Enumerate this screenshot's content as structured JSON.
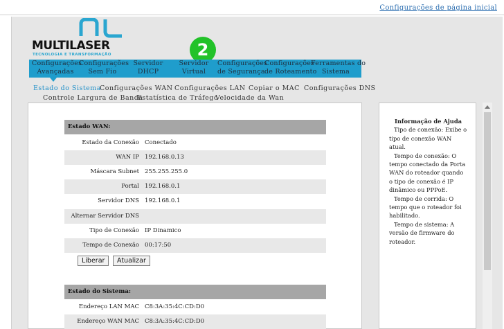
{
  "top": {
    "link": "Configurações de página inicial"
  },
  "logo": {
    "brand": "MULTILASER",
    "tagline": "TECNOLOGIA E TRANSFORMAÇÃO"
  },
  "badge": "2",
  "menu": [
    {
      "line1": "Configurações",
      "line2": "Avançadas"
    },
    {
      "line1": "Configurações",
      "line2": "Sem Fio"
    },
    {
      "line1": "Servidor",
      "line2": "DHCP"
    },
    {
      "line1": "Servidor",
      "line2": "Virtual"
    },
    {
      "line1": "Configurações",
      "line2": "de Segurança"
    },
    {
      "line1": "Configurações",
      "line2": "de Roteamento"
    },
    {
      "line1": "Ferramentas do",
      "line2": "Sistema"
    }
  ],
  "submenu": {
    "row1": [
      "Estado do Sistema",
      "Configurações WAN",
      "Configurações LAN",
      "Copiar o MAC",
      "Configurações DNS"
    ],
    "row2": [
      "Controle Largura de Banda",
      "Estatística de Tráfego",
      "Velocidade da Wan"
    ]
  },
  "wan": {
    "header": "Estado WAN:",
    "rows": [
      {
        "label": "Estado da Conexão",
        "value": "Conectado"
      },
      {
        "label": "WAN IP",
        "value": "192.168.0.13"
      },
      {
        "label": "Máscara Subnet",
        "value": "255.255.255.0"
      },
      {
        "label": "Portal",
        "value": "192.168.0.1"
      },
      {
        "label": "Servidor DNS",
        "value": "192.168.0.1"
      },
      {
        "label": "Alternar Servidor DNS",
        "value": ""
      },
      {
        "label": "Tipo de Conexão",
        "value": "IP Dinamico"
      },
      {
        "label": "Tempo de Conexão",
        "value": "00:17:50"
      }
    ],
    "buttons": {
      "release": "Liberar",
      "renew": "Atualizar"
    }
  },
  "system": {
    "header": "Estado do Sistema:",
    "rows": [
      {
        "label": "Endereço LAN MAC",
        "value": "C8:3A:35:4C:CD:D0"
      },
      {
        "label": "Endereço WAN MAC",
        "value": "C8:3A:35:4C:CD:D0"
      }
    ]
  },
  "help": {
    "title": "Informação de Ajuda",
    "paragraphs": [
      "Tipo de conexão: Exibe o tipo de conexão WAN atual.",
      "Tempo de conexão: O tempo conectado da Porta WAN do roteador quando o tipo de conexão é IP dinâmico ou PPPoE.",
      "Tempo de corrida: O tempo que o roteador foi habilitado.",
      "Tempo de sistema: A versão de firmware do roteador."
    ]
  },
  "colors": {
    "menu": "#1f9dcc",
    "accent_link": "#2a6db0",
    "badge": "#22c229",
    "section_header": "#a6a6a6"
  }
}
